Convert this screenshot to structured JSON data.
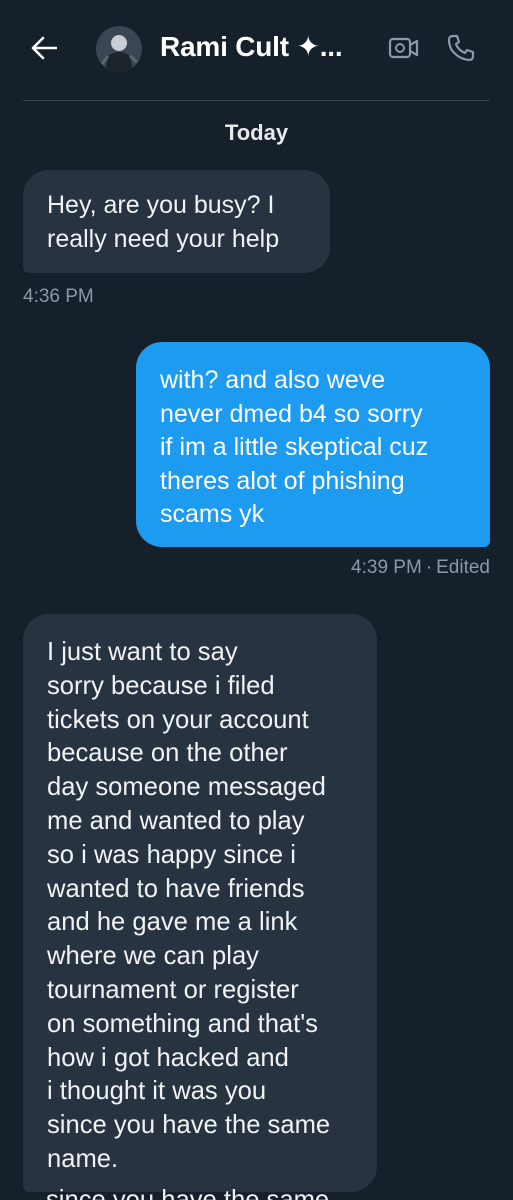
{
  "colors": {
    "background": "#15202b",
    "incoming_bubble": "#273340",
    "outgoing_bubble": "#1d9bf0",
    "muted_text": "#8b98a5",
    "divider": "#38444d"
  },
  "header": {
    "back_icon": "arrow-left-icon",
    "contact_name": "Rami Cult ✦...",
    "video_icon": "video-call-icon",
    "call_icon": "phone-icon"
  },
  "day_label": "Today",
  "messages": [
    {
      "direction": "incoming",
      "lines": [
        "Hey, are you busy? I",
        "really need your help"
      ],
      "time": "4:36 PM"
    },
    {
      "direction": "outgoing",
      "lines": [
        "with? and also weve",
        "never dmed b4 so sorry",
        "if im a little skeptical cuz",
        "theres alot of phishing",
        "scams yk"
      ],
      "time": "4:39 PM",
      "separator": "·",
      "edited": "Edited"
    },
    {
      "direction": "incoming",
      "lines": [
        "I just want to say",
        "sorry because i filed",
        "tickets on your account",
        "because on the other",
        "day someone messaged",
        "me and wanted to play",
        "so i was happy since i",
        "wanted to have friends",
        "and he gave me a link",
        "where we can play",
        "tournament or register",
        "on something and that's",
        "how i got hacked and",
        "i thought it was you",
        "since you have the same",
        "name."
      ]
    }
  ],
  "next_message_peek": "since you have the same"
}
